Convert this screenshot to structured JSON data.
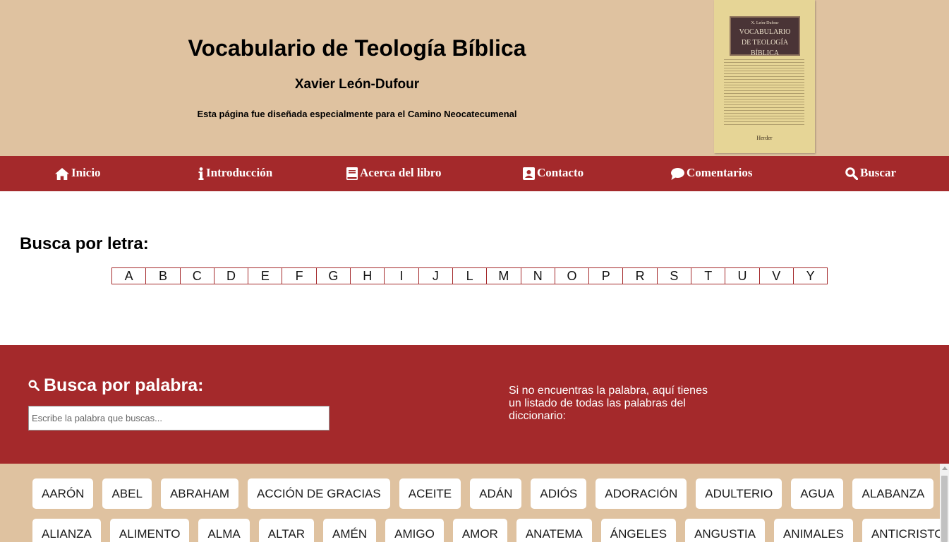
{
  "header": {
    "title": "Vocabulario de Teología Bíblica",
    "author": "Xavier León-Dufour",
    "note": "Esta página fue diseñada especialmente para el Camino Neocatecumenal",
    "book_cover": {
      "author_line": "X. León-Dufour",
      "title_lines": [
        "VOCABULARIO",
        "DE TEOLOGÍA",
        "BÍBLICA"
      ],
      "publisher": "Herder"
    }
  },
  "nav": {
    "items": [
      {
        "label": "Inicio",
        "icon": "home-icon"
      },
      {
        "label": "Introducción",
        "icon": "info-icon"
      },
      {
        "label": "Acerca del libro",
        "icon": "book-icon"
      },
      {
        "label": "Contacto",
        "icon": "contact-card-icon"
      },
      {
        "label": "Comentarios",
        "icon": "comment-icon"
      },
      {
        "label": "Buscar",
        "icon": "search-icon"
      }
    ]
  },
  "letters": {
    "title": "Busca por letra:",
    "items": [
      "A",
      "B",
      "C",
      "D",
      "E",
      "F",
      "G",
      "H",
      "I",
      "J",
      "L",
      "M",
      "N",
      "O",
      "P",
      "R",
      "S",
      "T",
      "U",
      "V",
      "Y"
    ]
  },
  "search": {
    "title": "Busca por palabra:",
    "placeholder": "Escribe la palabra que buscas...",
    "info": "Si no encuentras la palabra, aquí tienes un listado de todas las palabras del diccionario:"
  },
  "words": {
    "row1": [
      "AARÓN",
      "ABEL",
      "ABRAHAM",
      "ACCIÓN DE GRACIAS",
      "ACEITE",
      "ADÁN",
      "ADIÓS",
      "ADORACIÓN",
      "ADULTERIO",
      "AGUA",
      "ALABANZA"
    ],
    "row2": [
      "ALIANZA",
      "ALIMENTO",
      "ALMA",
      "ALTAR",
      "AMÉN",
      "AMIGO",
      "AMOR",
      "ANATEMA",
      "ÁNGELES",
      "ANGUSTIA",
      "ANIMALES",
      "ANTICRISTO"
    ]
  },
  "colors": {
    "accent": "#a4292b",
    "header_bg": "#dfc2a0"
  }
}
